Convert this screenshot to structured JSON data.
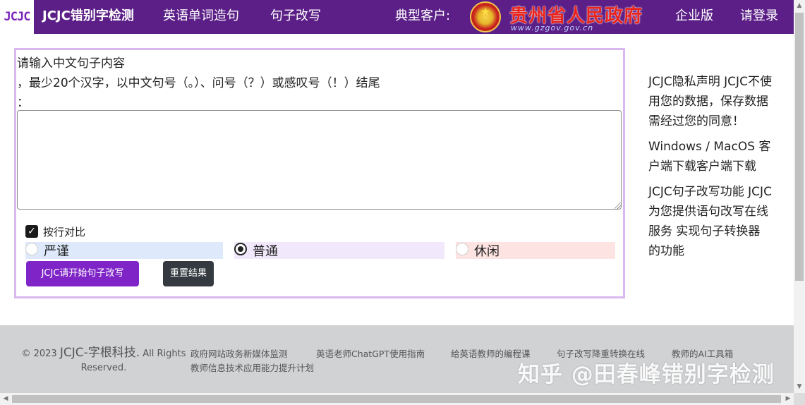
{
  "navbar": {
    "logo_text": "JCJC",
    "brand": "JCJC错别字检测",
    "links": [
      "英语单词造句",
      "句子改写"
    ],
    "customers_label": "典型客户:",
    "gov_name": "贵州省人民政府",
    "gov_url": "www.gzgov.gov.cn",
    "enterprise": "企业版",
    "login": "请登录",
    "bg_color": "#5b1f87"
  },
  "form": {
    "prompt_line1": "请输入中文句子内容",
    "prompt_line2": "，最少20个汉字，以中文句号（。）、问号（？）或感叹号（！）结尾",
    "prompt_line3": "：",
    "textarea_value": "",
    "checkbox_label": "按行对比",
    "checkbox_checked": true,
    "modes": [
      {
        "label": "严谨",
        "selected": false,
        "bg": "#deeafc"
      },
      {
        "label": "普通",
        "selected": true,
        "bg": "#f2e8fc"
      },
      {
        "label": "休闲",
        "selected": false,
        "bg": "#fde3e1"
      }
    ],
    "start_button": "JCJC请开始句子改写",
    "reset_button": "重置结果",
    "accent": "#7f25c8"
  },
  "sidebar": {
    "privacy": "JCJC隐私声明 JCJC不使用您的数据，保存数据需经过您的同意！",
    "download": "Windows / MacOS 客户端下载客户端下载",
    "feature": "JCJC句子改写功能 JCJC为您提供语句改写在线服务 实现句子转换器的功能"
  },
  "footer": {
    "copyright_prefix": "© 2023",
    "company": "JCJC-字根科技.",
    "rights": "All Rights Reserved.",
    "links": [
      "政府网站政务新媒体监测",
      "英语老师ChatGPT使用指南",
      "给英语教师的编程课",
      "句子改写降重转换在线",
      "教师的AI工具箱",
      "教师信息技术应用能力提升计划"
    ]
  },
  "watermark": "知乎 @田春峰错别字检测"
}
